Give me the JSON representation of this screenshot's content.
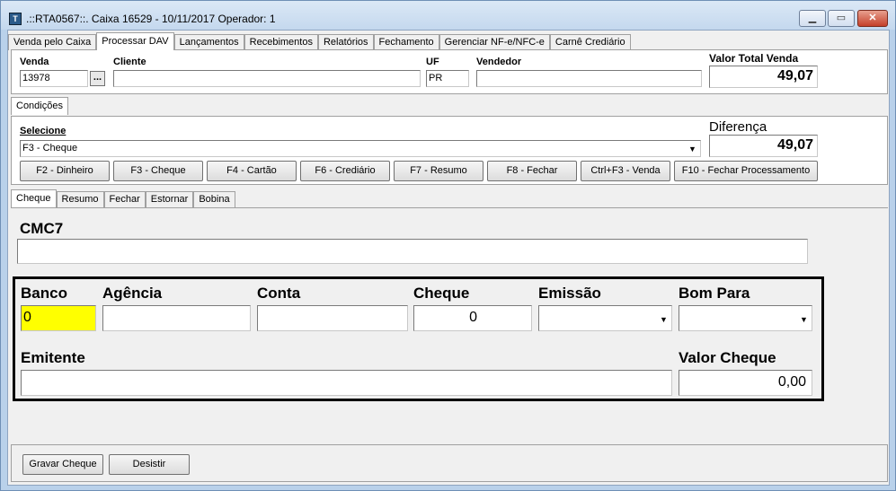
{
  "window": {
    "title": ".::RTA0567::. Caixa 16529 - 10/11/2017 Operador: 1",
    "min_glyph": "▁",
    "max_glyph": "▭",
    "close_glyph": "✕"
  },
  "main_tabs": [
    {
      "label": "Venda pelo Caixa"
    },
    {
      "label": "Processar DAV"
    },
    {
      "label": "Lançamentos"
    },
    {
      "label": "Recebimentos"
    },
    {
      "label": "Relatórios"
    },
    {
      "label": "Fechamento"
    },
    {
      "label": "Gerenciar NF-e/NFC-e"
    },
    {
      "label": "Carnê Crediário"
    }
  ],
  "header": {
    "venda_label": "Venda",
    "venda_value": "13978",
    "venda_lookup": "...",
    "cliente_label": "Cliente",
    "cliente_value": "",
    "uf_label": "UF",
    "uf_value": "PR",
    "vendedor_label": "Vendedor",
    "vendedor_value": "",
    "valor_total_label": "Valor Total Venda",
    "valor_total_value": "49,07"
  },
  "condicoes_tab": "Condições",
  "condicoes": {
    "selecione_label": "Selecione",
    "selecione_value": "F3 - Cheque",
    "diferenca_label": "Diferença",
    "diferenca_value": "49,07",
    "buttons": [
      {
        "label": "F2 - Dinheiro"
      },
      {
        "label": "F3 - Cheque"
      },
      {
        "label": "F4 - Cartão"
      },
      {
        "label": "F6 - Crediário"
      },
      {
        "label": "F7 - Resumo"
      },
      {
        "label": "F8 - Fechar"
      },
      {
        "label": "Ctrl+F3 - Venda"
      },
      {
        "label": "F10 - Fechar Processamento"
      }
    ]
  },
  "sub_tabs": [
    {
      "label": "Cheque"
    },
    {
      "label": "Resumo"
    },
    {
      "label": "Fechar"
    },
    {
      "label": "Estornar"
    },
    {
      "label": "Bobina"
    }
  ],
  "cheque": {
    "cmc7_label": "CMC7",
    "cmc7_value": "",
    "banco_label": "Banco",
    "banco_value": "0",
    "agencia_label": "Agência",
    "agencia_value": "",
    "conta_label": "Conta",
    "conta_value": "",
    "cheque_label": "Cheque",
    "cheque_value": "0",
    "emissao_label": "Emissão",
    "emissao_value": "",
    "bom_para_label": "Bom Para",
    "bom_para_value": "",
    "emitente_label": "Emitente",
    "emitente_value": "",
    "valor_cheque_label": "Valor Cheque",
    "valor_cheque_value": "0,00"
  },
  "footer": {
    "gravar_label": "Gravar Cheque",
    "desistir_label": "Desistir"
  },
  "colors": {
    "active_field": "#ffff00",
    "title_bar": "#c4d8ee"
  }
}
